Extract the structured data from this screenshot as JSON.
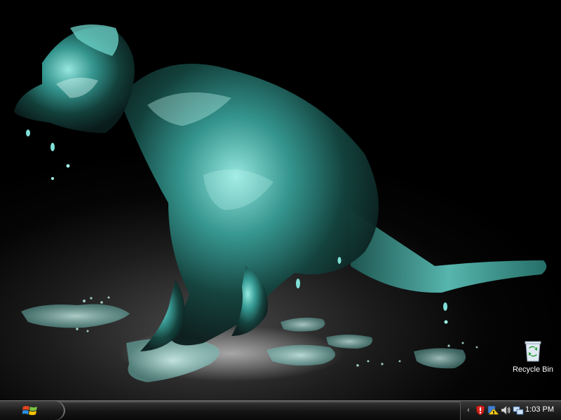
{
  "desktop": {
    "icons": [
      {
        "label": "Recycle Bin",
        "icon": "recycle-bin-icon"
      }
    ]
  },
  "taskbar": {
    "start_icon": "windows-logo-icon",
    "tray_icons": [
      "shield-alert-icon",
      "security-warning-icon",
      "volume-icon",
      "network-icon"
    ],
    "clock": "1:03 PM"
  },
  "colors": {
    "wallpaper_glass": "#4fd0c6",
    "taskbar": "#141414",
    "text": "#ffffff"
  }
}
